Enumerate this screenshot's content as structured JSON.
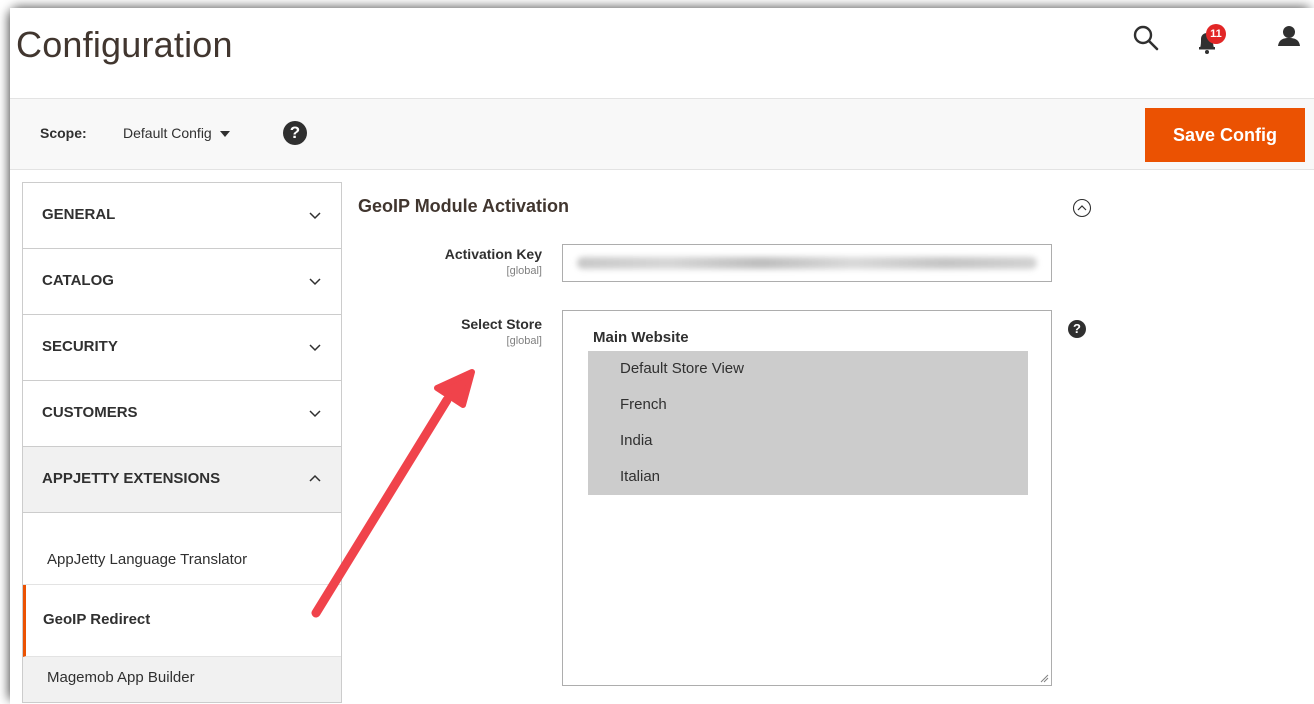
{
  "header": {
    "title": "Configuration",
    "notifications_count": "11",
    "icons": [
      "search-icon",
      "bell-icon",
      "user-icon"
    ]
  },
  "scope": {
    "label": "Scope:",
    "value": "Default Config",
    "help": "?"
  },
  "actions": {
    "save_label": "Save Config"
  },
  "sidebar": {
    "tabs": [
      {
        "label": "GENERAL",
        "expanded": false
      },
      {
        "label": "CATALOG",
        "expanded": false
      },
      {
        "label": "SECURITY",
        "expanded": false
      },
      {
        "label": "CUSTOMERS",
        "expanded": false
      },
      {
        "label": "APPJETTY EXTENSIONS",
        "expanded": true
      }
    ],
    "sub_items": [
      {
        "label": "AppJetty Language Translator",
        "active": false
      },
      {
        "label": "GeoIP Redirect",
        "active": true
      },
      {
        "label": "Magemob App Builder",
        "active": false
      }
    ]
  },
  "section": {
    "title": "GeoIP Module Activation",
    "fields": {
      "activation_key": {
        "label": "Activation Key",
        "scope": "[global]"
      },
      "select_store": {
        "label": "Select Store",
        "scope": "[global]",
        "group": "Main Website",
        "options": [
          "Default Store View",
          "French",
          "India",
          "Italian"
        ],
        "help": "?"
      }
    }
  },
  "colors": {
    "accent": "#eb5202",
    "badge": "#e22626",
    "annotation_arrow": "#f0434b",
    "selected_option": "#cccccc"
  }
}
